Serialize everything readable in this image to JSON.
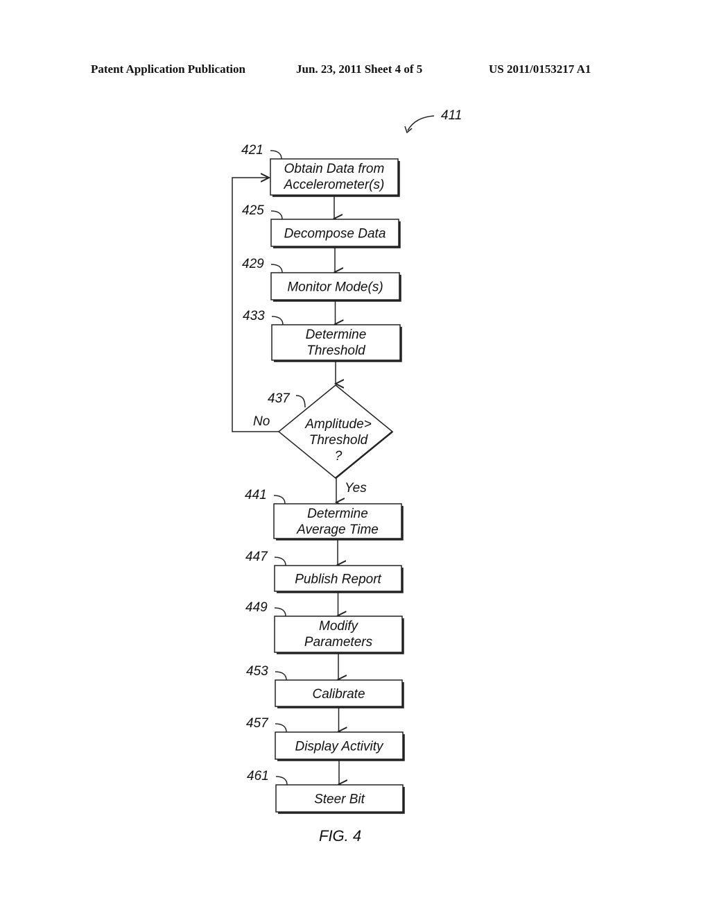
{
  "header": {
    "publication": "Patent Application Publication",
    "date_sheet": "Jun. 23, 2011   Sheet 4 of 5",
    "number": "US 2011/0153217 A1"
  },
  "figure": {
    "ref": "411",
    "caption": "FIG. 4",
    "steps": [
      {
        "ref": "421",
        "lines": [
          "Obtain Data from",
          "Accelerometer(s)"
        ]
      },
      {
        "ref": "425",
        "lines": [
          "Decompose Data"
        ]
      },
      {
        "ref": "429",
        "lines": [
          "Monitor Mode(s)"
        ]
      },
      {
        "ref": "433",
        "lines": [
          "Determine",
          "Threshold"
        ]
      },
      {
        "ref": "437",
        "lines": [
          "Amplitude>",
          "Threshold",
          "?"
        ],
        "decision": true,
        "no_label": "No",
        "yes_label": "Yes"
      },
      {
        "ref": "441",
        "lines": [
          "Determine",
          "Average Time"
        ]
      },
      {
        "ref": "447",
        "lines": [
          "Publish Report"
        ]
      },
      {
        "ref": "449",
        "lines": [
          "Modify",
          "Parameters"
        ]
      },
      {
        "ref": "453",
        "lines": [
          "Calibrate"
        ]
      },
      {
        "ref": "457",
        "lines": [
          "Display Activity"
        ]
      },
      {
        "ref": "461",
        "lines": [
          "Steer Bit"
        ]
      }
    ]
  }
}
